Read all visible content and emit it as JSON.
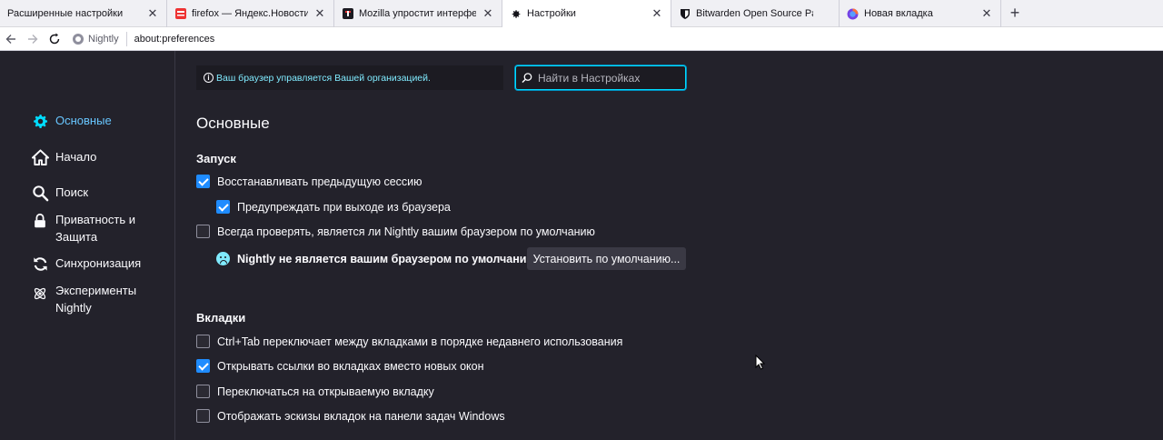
{
  "tabs": [
    {
      "title": "Расширенные настройки",
      "favicon": "none",
      "active": false
    },
    {
      "title": "firefox — Яндекс.Новости: на",
      "favicon": "yandex-icon",
      "active": false
    },
    {
      "title": "Mozilla упростит интерфейс н",
      "favicon": "site-icon",
      "active": false
    },
    {
      "title": "Настройки",
      "favicon": "gear-icon",
      "active": true
    },
    {
      "title": "Bitwarden Open Source Passw",
      "favicon": "shield-icon",
      "active": false
    },
    {
      "title": "Новая вкладка",
      "favicon": "firefox-icon",
      "active": false
    }
  ],
  "navbar": {
    "identity_label": "Nightly",
    "url": "about:preferences"
  },
  "sidebar": {
    "items": [
      {
        "label": "Основные",
        "icon": "gear-icon",
        "selected": true
      },
      {
        "label": "Начало",
        "icon": "home-icon",
        "selected": false
      },
      {
        "label": "Поиск",
        "icon": "search-icon",
        "selected": false
      },
      {
        "label": "Приватность и Защита",
        "icon": "lock-icon",
        "selected": false
      },
      {
        "label": "Синхронизация",
        "icon": "sync-icon",
        "selected": false
      },
      {
        "label": "Эксперименты Nightly",
        "icon": "atom-icon",
        "selected": false
      }
    ]
  },
  "policy_notice": "Ваш браузер управляется Вашей организацией.",
  "search": {
    "placeholder": "Найти в Настройках",
    "value": ""
  },
  "main": {
    "title": "Основные",
    "startup": {
      "heading": "Запуск",
      "restore_session": {
        "label": "Восстанавливать предыдущую сессию",
        "checked": true
      },
      "warn_on_quit": {
        "label": "Предупреждать при выходе из браузера",
        "checked": true
      },
      "check_default": {
        "label": "Всегда проверять, является ли Nightly вашим браузером по умолчанию",
        "checked": false
      },
      "not_default_text": "Nightly не является вашим браузером по умолчанию",
      "set_default_button": "Установить по умолчанию..."
    },
    "tabs_section": {
      "heading": "Вкладки",
      "ctrl_tab": {
        "label": "Ctrl+Tab переключает между вкладками в порядке недавнего использования",
        "checked": false
      },
      "open_links_in_tabs": {
        "label": "Открывать ссылки во вкладках вместо новых окон",
        "checked": true
      },
      "switch_to_new_tab": {
        "label": "Переключаться на открываемую вкладку",
        "checked": false
      },
      "taskbar_previews": {
        "label": "Отображать эскизы вкладок на панели задач Windows",
        "checked": false
      }
    }
  },
  "colors": {
    "accent": "#00ddff",
    "checkbox": "#1f8cff",
    "background": "#23222b"
  }
}
